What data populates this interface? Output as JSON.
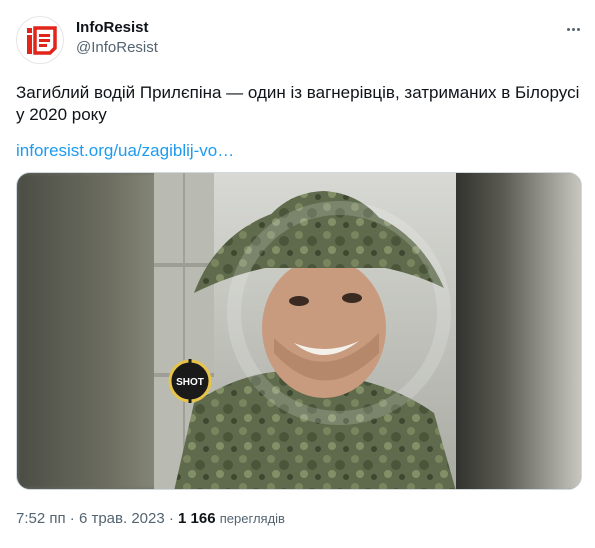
{
  "author": {
    "name": "InfoResist",
    "handle": "@InfoResist",
    "avatar_icon": "infresist-logo-icon",
    "avatar_color": "#e1251b"
  },
  "tweet": {
    "text": "Загиблий водій Прилєпіна — один із вагнерівців, затриманих в Білорусі у 2020 року",
    "link_text": "inforesist.org/ua/zagiblij-vo…",
    "link_color": "#1d9bf0"
  },
  "media": {
    "watermark_text": "SHOT"
  },
  "footer": {
    "time": "7:52 пп",
    "separator": "·",
    "date": "6 трав. 2023",
    "views_count": "1 166",
    "views_label": "переглядів"
  },
  "menu_icon": "more-horizontal-icon"
}
